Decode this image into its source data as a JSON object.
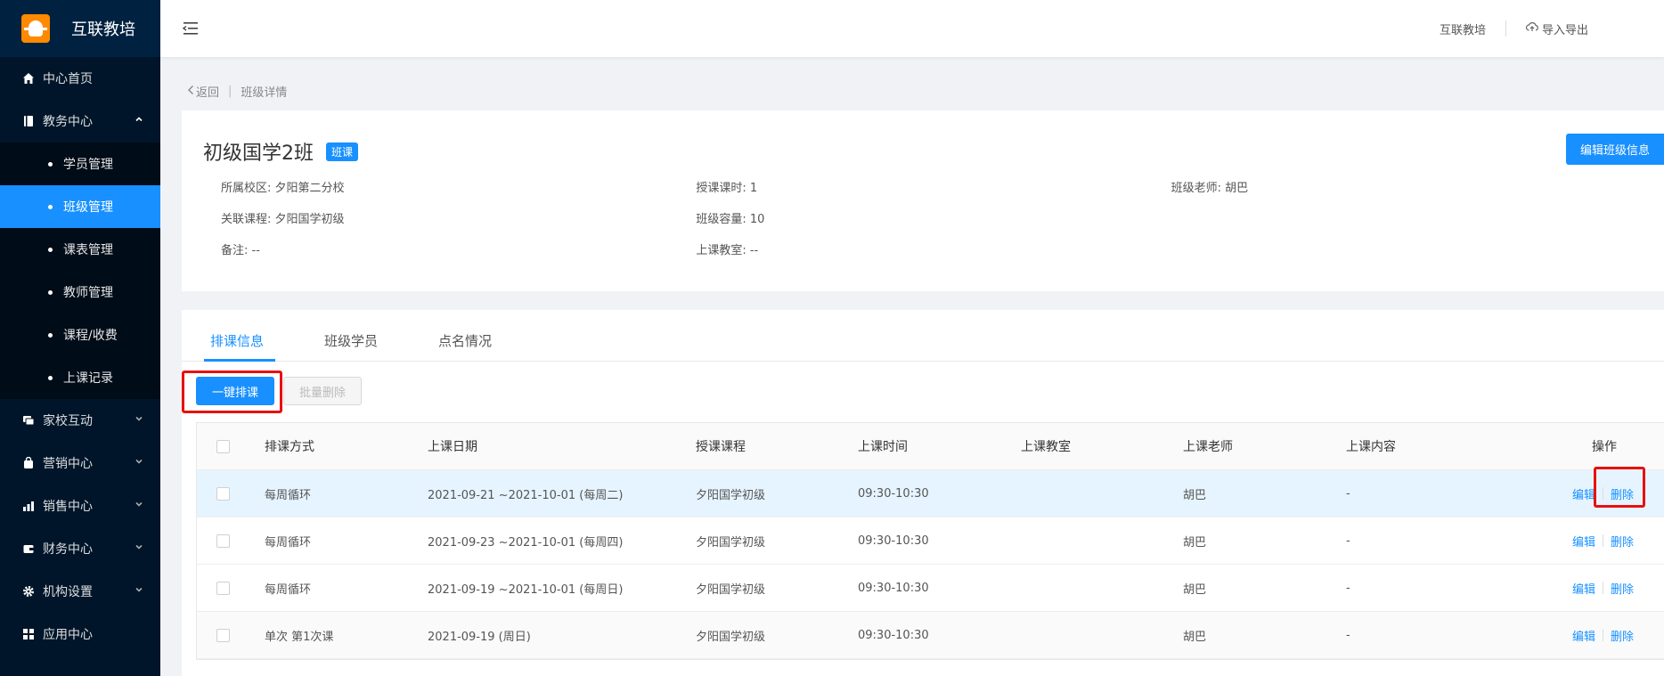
{
  "brand": {
    "title": "互联教培",
    "logo_icon": "lightbulb-logo"
  },
  "sidebar": {
    "items": [
      {
        "label": "中心首页",
        "icon": "home-icon"
      },
      {
        "label": "教务中心",
        "icon": "book-icon",
        "expanded": true
      },
      {
        "label": "家校互动",
        "icon": "chat-icon"
      },
      {
        "label": "营销中心",
        "icon": "bag-icon"
      },
      {
        "label": "销售中心",
        "icon": "chart-icon"
      },
      {
        "label": "财务中心",
        "icon": "wallet-icon"
      },
      {
        "label": "机构设置",
        "icon": "gear-icon"
      },
      {
        "label": "应用中心",
        "icon": "grid-icon"
      }
    ],
    "subitems": [
      {
        "label": "学员管理"
      },
      {
        "label": "班级管理",
        "active": true
      },
      {
        "label": "课表管理"
      },
      {
        "label": "教师管理"
      },
      {
        "label": "课程/收费"
      },
      {
        "label": "上课记录"
      }
    ]
  },
  "header": {
    "org_name": "互联教培",
    "import_export": "导入导出"
  },
  "breadcrumb": {
    "back": "返回",
    "sep": "|",
    "current": "班级详情"
  },
  "class_info": {
    "title": "初级国学2班",
    "tag": "班课",
    "edit_button": "编辑班级信息",
    "rows": [
      [
        "所属校区: 夕阳第二分校",
        "授课课时: 1",
        "班级老师:  胡巴"
      ],
      [
        "关联课程: 夕阳国学初级",
        "班级容量: 10",
        ""
      ],
      [
        "备注: --",
        "上课教室: --",
        ""
      ]
    ]
  },
  "tabs": [
    {
      "label": "排课信息",
      "active": true
    },
    {
      "label": "班级学员"
    },
    {
      "label": "点名情况"
    }
  ],
  "actions": {
    "auto_schedule": "一键排课",
    "batch_delete": "批量删除"
  },
  "table": {
    "columns": [
      "排课方式",
      "上课日期",
      "授课课程",
      "上课时间",
      "上课教室",
      "上课老师",
      "上课内容",
      "操作"
    ],
    "rows": [
      {
        "mode": "每周循环",
        "date": "2021-09-21 ~2021-10-01 (每周二)",
        "course": "夕阳国学初级",
        "time": "09:30-10:30",
        "room": "",
        "teacher": "胡巴",
        "content": "-",
        "edit": "编辑",
        "delete": "删除"
      },
      {
        "mode": "每周循环",
        "date": "2021-09-23 ~2021-10-01 (每周四)",
        "course": "夕阳国学初级",
        "time": "09:30-10:30",
        "room": "",
        "teacher": "胡巴",
        "content": "-",
        "edit": "编辑",
        "delete": "删除"
      },
      {
        "mode": "每周循环",
        "date": "2021-09-19 ~2021-10-01 (每周日)",
        "course": "夕阳国学初级",
        "time": "09:30-10:30",
        "room": "",
        "teacher": "胡巴",
        "content": "-",
        "edit": "编辑",
        "delete": "删除"
      },
      {
        "mode": "单次 第1次课",
        "date": "2021-09-19 (周日)",
        "course": "夕阳国学初级",
        "time": "09:30-10:30",
        "room": "",
        "teacher": "胡巴",
        "content": "-",
        "edit": "编辑",
        "delete": "删除"
      }
    ]
  },
  "colors": {
    "accent": "#1890ff",
    "sidebar_bg": "#001529",
    "highlight_box": "#e81010"
  }
}
